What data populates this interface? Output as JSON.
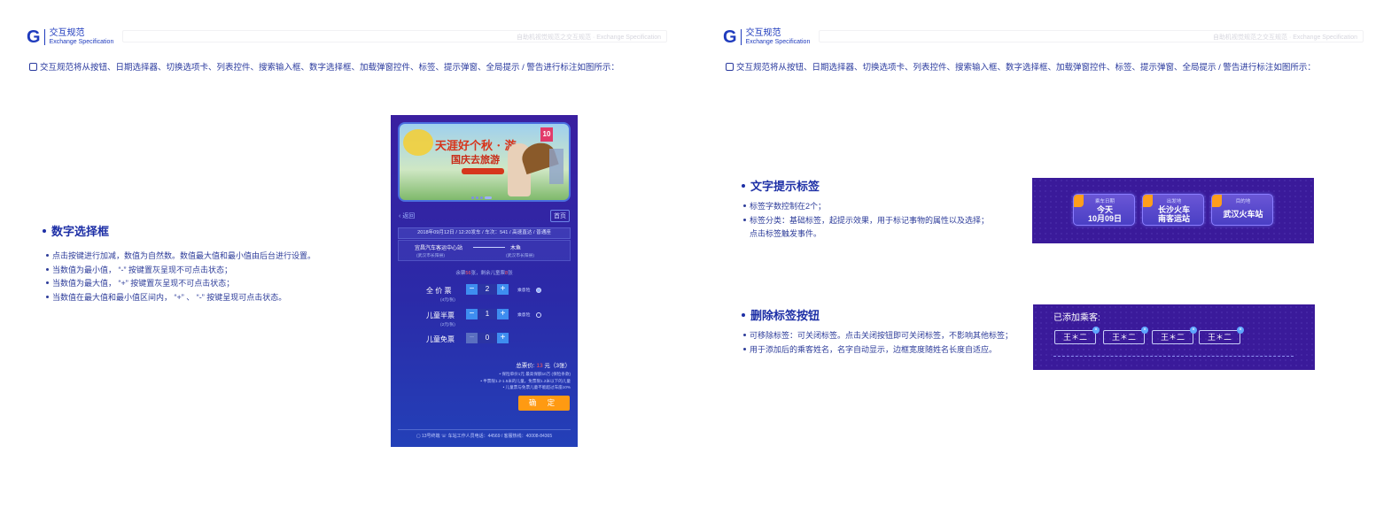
{
  "brand": {
    "logo_letter": "G",
    "title_cn": "交互规范",
    "title_en": "Exchange Specification",
    "header_watermark": "自助机视觉规范之交互规范 · Exchange Specification"
  },
  "intro_text": "交互规范将从按钮、日期选择器、切换选项卡、列表控件、搜索输入框、数字选择框、加载弹窗控件、标签、提示弹窗、全局提示 / 警告进行标注如图所示：",
  "number_selector": {
    "title": "数字选择框",
    "bullets": [
      "点击按键进行加减，数值为自然数。数值最大值和最小值由后台进行设置。",
      "当数值为最小值， “-” 按键置灰呈现不可点击状态；",
      "当数值为最大值， “+” 按键置灰呈现不可点击状态；",
      "当数值在最大值和最小值区间内， “+” 、 “-” 按键呈现可点击状态。"
    ]
  },
  "phone": {
    "banner": {
      "slogan_line1": "天涯好个秋 · 游",
      "slogan_line2": "国庆去旅游",
      "badge": "10"
    },
    "back_label": "返回",
    "home_label": "首页",
    "trip_info": "2018年09月12日 / 12:20发车 / 车次：541 / 高速直达 / 普通座",
    "from_station": "宜昌汽车客运中心站",
    "from_sub": "(武汉市长阳县)",
    "to_station": "木鱼",
    "to_sub": "(武汉市长阳县)",
    "remaining": {
      "prefix": "余票",
      "count": "56",
      "middle": "张，剩余儿童票",
      "child_count": "8",
      "suffix": "张"
    },
    "tickets": [
      {
        "name": "全 价 票",
        "price": "(4元/张)",
        "value": "2",
        "insurance": "乘意险",
        "minus_disabled": false,
        "plus_disabled": false,
        "selected": true
      },
      {
        "name": "儿童半票",
        "price": "(2元/张)",
        "value": "1",
        "insurance": "乘意险",
        "minus_disabled": false,
        "plus_disabled": false,
        "selected": false
      },
      {
        "name": "儿童免票",
        "price": "",
        "value": "0",
        "insurance": "",
        "minus_disabled": true,
        "plus_disabled": false,
        "selected": false
      }
    ],
    "total": {
      "label": "总票价:",
      "amount": "13",
      "unit": "元（3张）"
    },
    "notes": [
      "• 保险单价1元 最高保额10万 (保险条款)",
      "• 半票限1.2-1.5米的儿童。免票限1.2米以下的儿童",
      "• 儿童票与免票儿童不能超过车座10%"
    ],
    "confirm_label": "确 定",
    "footer": "▢ 13号终端   ☏ 车站工作人员电话：44569 / 客服热线：40008-84365"
  },
  "text_tags": {
    "title": "文字提示标签",
    "bullets": [
      "标签字数控制在2个；",
      "标签分类：基础标签，起提示效果，用于标记事物的属性以及选择；"
    ],
    "bullet_continuation": "点击标签触发事件。",
    "chips": [
      {
        "label": "乘车日期",
        "value_line1": "今天",
        "value_line2": "10月09日"
      },
      {
        "label": "出发地",
        "value_line1": "长沙火车",
        "value_line2": "南客运站"
      },
      {
        "label": "目的地",
        "value_line1": "武汉火车站",
        "value_line2": ""
      }
    ]
  },
  "delete_tags": {
    "title": "删除标签按钮",
    "bullets": [
      "可移除标签：可关闭标签。点击关闭按钮即可关闭标签，不影响其他标签；",
      "用于添加后的乘客姓名，名字自动显示，边框宽度随姓名长度自适应。"
    ],
    "panel_title": "已添加乘客:",
    "passengers": [
      "王＊二",
      "王＊二",
      "王＊二",
      "王＊二"
    ],
    "close_glyph": "×"
  },
  "colors": {
    "brand_blue": "#1f3bbd",
    "panel_purple": "#3a1a9a",
    "confirm_orange": "#ff9a12",
    "stepper_blue": "#3e8df0"
  }
}
